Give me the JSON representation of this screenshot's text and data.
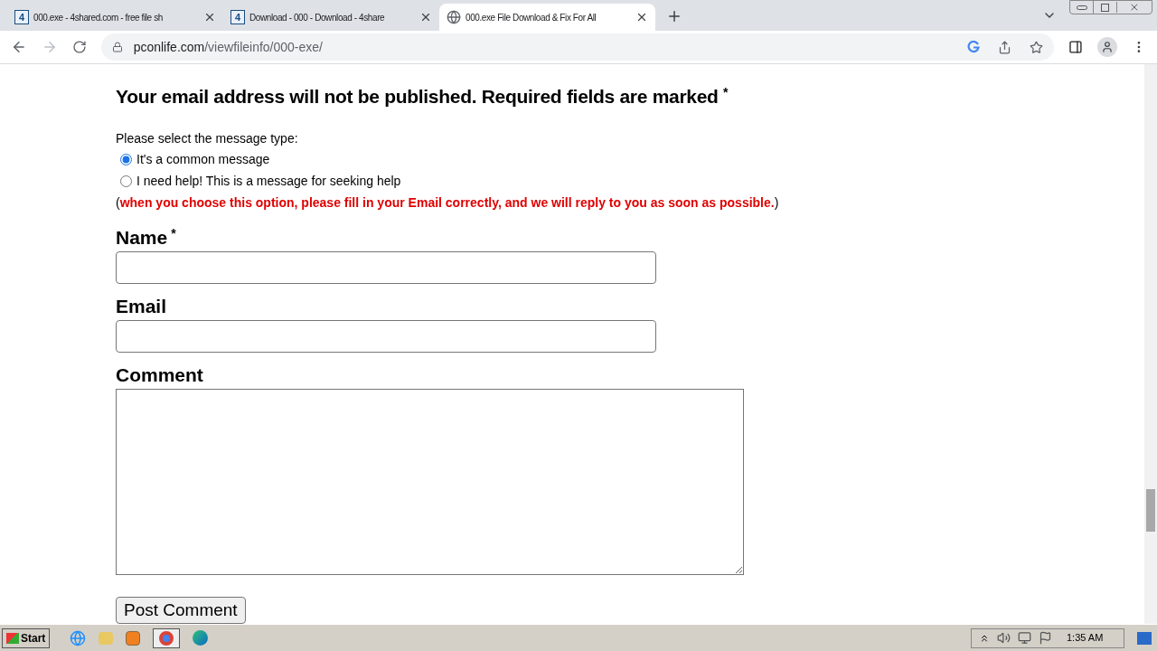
{
  "tabs": [
    {
      "title": "000.exe - 4shared.com - free file sh",
      "badge": "4",
      "selected": false
    },
    {
      "title": "Download - 000 - Download - 4share",
      "badge": "4",
      "selected": false
    },
    {
      "title": "000.exe File Download & Fix For All",
      "selected": true
    }
  ],
  "address": {
    "host": "pconlife.com",
    "path": "/viewfileinfo/000-exe/"
  },
  "form": {
    "heading": "Your email address will not be published. Required fields are marked",
    "required_mark": "*",
    "type_prompt": "Please select the message type:",
    "options": [
      {
        "label": "It's a common message",
        "selected": true
      },
      {
        "label": "I need help! This is a message for seeking help",
        "selected": false
      }
    ],
    "help_note": {
      "open": "(",
      "text": "when you choose this option, please fill in your Email correctly, and we will reply to you as soon as possible.",
      "close": ")"
    },
    "fields": [
      {
        "label": "Name",
        "required": true,
        "kind": "input"
      },
      {
        "label": "Email",
        "required": false,
        "kind": "input"
      },
      {
        "label": "Comment",
        "required": false,
        "kind": "textarea"
      }
    ],
    "submit": "Post Comment"
  },
  "taskbar": {
    "start": "Start",
    "clock": "1:35 AM"
  }
}
